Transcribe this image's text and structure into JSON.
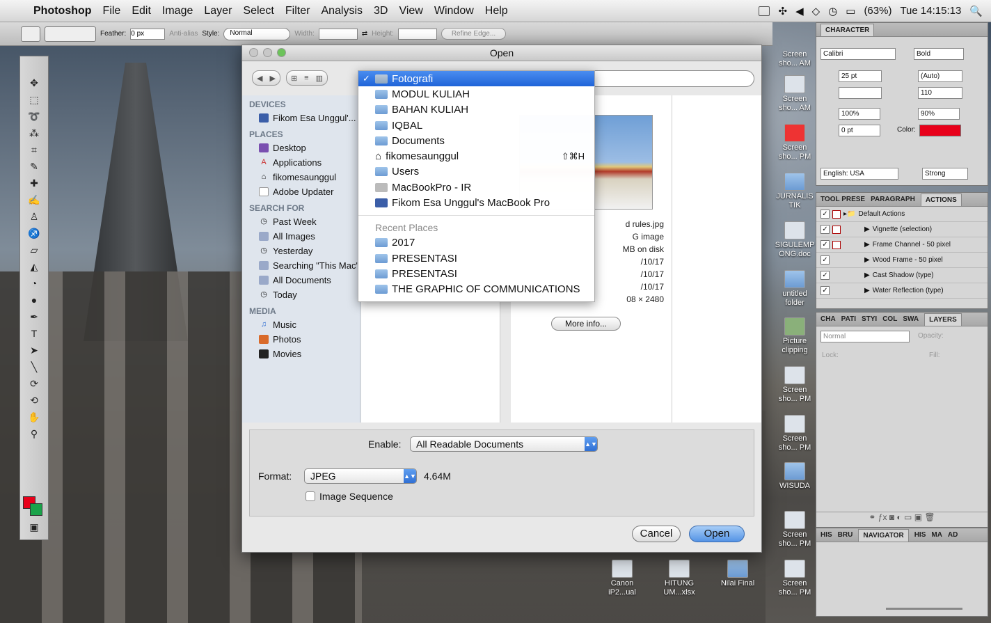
{
  "menubar": {
    "apple": "",
    "items": [
      "Photoshop",
      "File",
      "Edit",
      "Image",
      "Layer",
      "Select",
      "Filter",
      "Analysis",
      "3D",
      "View",
      "Window",
      "Help"
    ],
    "battery": "(63%)",
    "clock": "Tue 14:15:13"
  },
  "optbar": {
    "feather_label": "Feather:",
    "feather_value": "0 px",
    "antialias": "Anti-alias",
    "style_label": "Style:",
    "style_value": "Normal",
    "width_label": "Width:",
    "height_label": "Height:",
    "refine": "Refine Edge..."
  },
  "dialog": {
    "title": "Open",
    "sidebar": {
      "devices_head": "DEVICES",
      "devices": [
        "Fikom Esa Unggul'..."
      ],
      "places_head": "PLACES",
      "places": [
        "Desktop",
        "Applications",
        "fikomesaunggul",
        "Adobe Updater"
      ],
      "search_head": "SEARCH FOR",
      "search": [
        "Past Week",
        "All Images",
        "Yesterday",
        "Searching \"This Mac\"",
        "All Documents",
        "Today"
      ],
      "media_head": "MEDIA",
      "media": [
        "Music",
        "Photos",
        "Movies"
      ]
    },
    "info": {
      "name": "d rules.jpg",
      "kind": "G image",
      "size": "MB on disk",
      "created": "/10/17",
      "modified": "/10/17",
      "opened": "/10/17",
      "dims": "08 × 2480"
    },
    "more_info": "More info...",
    "enable_label": "Enable:",
    "enable_value": "All Readable Documents",
    "format_label": "Format:",
    "format_value": "JPEG",
    "format_size": "4.64M",
    "image_sequence": "Image Sequence",
    "cancel": "Cancel",
    "open": "Open"
  },
  "dropdown": {
    "items": [
      {
        "label": "Fotografi",
        "selected": true
      },
      {
        "label": "MODUL KULIAH"
      },
      {
        "label": "BAHAN KULIAH"
      },
      {
        "label": "IQBAL"
      },
      {
        "label": "Documents"
      },
      {
        "label": "fikomesaunggul",
        "shortcut": "⇧⌘H"
      },
      {
        "label": "Users"
      },
      {
        "label": "MacBookPro - IR"
      },
      {
        "label": "Fikom Esa Unggul's MacBook Pro"
      }
    ],
    "recent_head": "Recent Places",
    "recent": [
      "2017",
      "PRESENTASI",
      "PRESENTASI",
      "THE GRAPHIC OF COMMUNICATIONS"
    ]
  },
  "desktop_icons": [
    {
      "label": "Screen sho... AM"
    },
    {
      "label": "Screen sho... AM"
    },
    {
      "label": "Screen sho... PM"
    },
    {
      "label": "JURNALIS TIK"
    },
    {
      "label": "SIGULEMP ONG.doc"
    },
    {
      "label": "untitled folder"
    },
    {
      "label": "Picture clipping"
    },
    {
      "label": "Screen sho... PM"
    },
    {
      "label": "Screen sho... PM"
    },
    {
      "label": "WISUDA"
    },
    {
      "label": "Screen sho... PM"
    },
    {
      "label": "Screen sho... PM"
    },
    {
      "label": "Canon iP2...ual"
    },
    {
      "label": "HITUNG UM...xlsx"
    },
    {
      "label": "Nilai Final"
    }
  ],
  "character": {
    "tab": "CHARACTER",
    "font": "Calibri",
    "style": "Bold",
    "size": "25 pt",
    "leading": "(Auto)",
    "tracking": "110",
    "vscale": "100%",
    "hscale": "90%",
    "baseline": "0 pt",
    "color_label": "Color:",
    "language": "English: USA",
    "aa": "Strong"
  },
  "actions": {
    "tabs": [
      "TOOL PRESE",
      "PARAGRAPH",
      "ACTIONS"
    ],
    "rows": [
      "Default Actions",
      "Vignette (selection)",
      "Frame Channel - 50 pixel",
      "Wood Frame - 50 pixel",
      "Cast Shadow (type)",
      "Water Reflection (type)"
    ]
  },
  "layers": {
    "tabs": [
      "CHA",
      "PATI",
      "STYI",
      "COL",
      "SWA",
      "LAYERS"
    ],
    "blend": "Normal",
    "opacity_label": "Opacity:",
    "lock_label": "Lock:",
    "fill_label": "Fill:"
  },
  "navigator": {
    "tabs": [
      "HIS",
      "BRU",
      "NAVIGATOR",
      "HIS",
      "MA",
      "AD"
    ]
  },
  "colors": {
    "fg": "#e8001a",
    "bg": "#1aa34a",
    "accent": "#1f64d8"
  }
}
